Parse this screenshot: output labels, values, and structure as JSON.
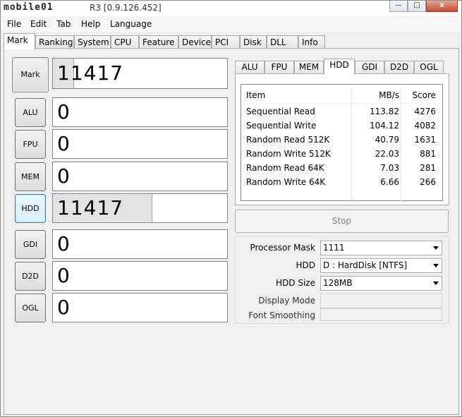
{
  "window": {
    "logo_text": "mobile01",
    "title": "R3 [0.9.126.452]",
    "minimize_label": "—",
    "maximize_label": "□",
    "close_label": "x"
  },
  "menu": [
    "File",
    "Edit",
    "Tab",
    "Help",
    "Language"
  ],
  "main_tabs": [
    "Mark",
    "Ranking",
    "System",
    "CPU",
    "Feature",
    "Device",
    "PCI",
    "Disk",
    "DLL",
    "Info"
  ],
  "active_main_tab": "Mark",
  "categories": [
    {
      "label": "Mark",
      "score": "11417",
      "bar_fraction": 0.12
    },
    {
      "label": "ALU",
      "score": "0",
      "bar_fraction": 0
    },
    {
      "label": "FPU",
      "score": "0",
      "bar_fraction": 0
    },
    {
      "label": "MEM",
      "score": "0",
      "bar_fraction": 0
    },
    {
      "label": "HDD",
      "score": "11417",
      "bar_fraction": 0.57
    },
    {
      "label": "GDI",
      "score": "0",
      "bar_fraction": 0
    },
    {
      "label": "D2D",
      "score": "0",
      "bar_fraction": 0
    },
    {
      "label": "OGL",
      "score": "0",
      "bar_fraction": 0
    }
  ],
  "sub_tabs": [
    "ALU",
    "FPU",
    "MEM",
    "HDD",
    "GDI",
    "D2D",
    "OGL"
  ],
  "active_sub_tab": "HDD",
  "results": {
    "columns": [
      "Item",
      "MB/s",
      "Score"
    ],
    "rows": [
      {
        "item": "Sequential Read",
        "mbs": "113.82",
        "score": "4276"
      },
      {
        "item": "Sequential Write",
        "mbs": "104.12",
        "score": "4082"
      },
      {
        "item": "Random Read 512K",
        "mbs": "40.79",
        "score": "1631"
      },
      {
        "item": "Random Write 512K",
        "mbs": "22.03",
        "score": "881"
      },
      {
        "item": "Random Read 64K",
        "mbs": "7.03",
        "score": "281"
      },
      {
        "item": "Random Write 64K",
        "mbs": "6.66",
        "score": "266"
      }
    ]
  },
  "stop_label": "Stop",
  "settings": {
    "processor_mask_label": "Processor Mask",
    "processor_mask_value": "1111",
    "hdd_label": "HDD",
    "hdd_value": "D : HardDisk [NTFS]",
    "hdd_size_label": "HDD Size",
    "hdd_size_value": "128MB",
    "display_mode_label": "Display Mode",
    "display_mode_value": "",
    "font_smoothing_label": "Font Smoothing",
    "font_smoothing_value": ""
  }
}
